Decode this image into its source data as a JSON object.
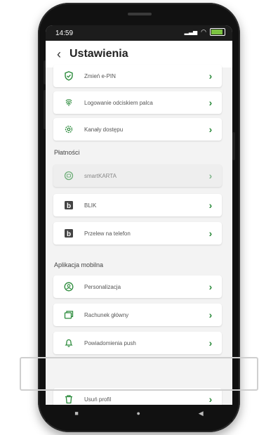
{
  "status": {
    "time": "14:59"
  },
  "header": {
    "title": "Ustawienia"
  },
  "sections": [
    {
      "title": "",
      "items": [
        {
          "label": "Zmień e-PIN",
          "icon": "shield-icon",
          "disabled": false
        },
        {
          "label": "Logowanie odciskiem palca",
          "icon": "fingerprint-icon",
          "disabled": false
        },
        {
          "label": "Kanały dostępu",
          "icon": "gear-icon",
          "disabled": false
        }
      ]
    },
    {
      "title": "Płatności",
      "items": [
        {
          "label": "smartKARTA",
          "icon": "smartcard-icon",
          "disabled": true
        },
        {
          "label": "BLIK",
          "icon": "blik-icon",
          "disabled": false
        },
        {
          "label": "Przelew na telefon",
          "icon": "blik-icon",
          "disabled": false
        }
      ]
    },
    {
      "title": "Aplikacja mobilna",
      "items": [
        {
          "label": "Personalizacja",
          "icon": "person-icon",
          "disabled": false
        },
        {
          "label": "Rachunek główny",
          "icon": "account-icon",
          "disabled": false
        },
        {
          "label": "Powiadomienia push",
          "icon": "bell-icon",
          "disabled": false
        },
        {
          "label": "Usuń profil",
          "icon": "trash-icon",
          "disabled": false
        }
      ]
    }
  ],
  "colors": {
    "accent": "#2a8a3a",
    "background": "#f3f3f3"
  }
}
